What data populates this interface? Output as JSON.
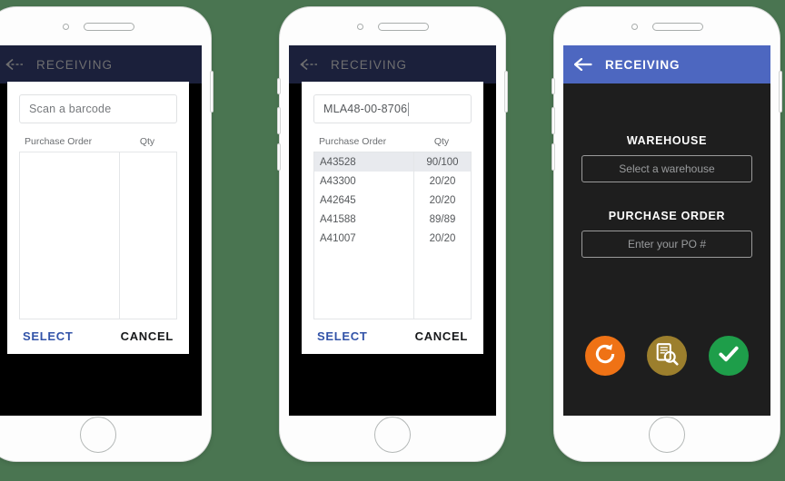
{
  "theme": {
    "page_background": "#4a7551",
    "header_navy": "#1b203b",
    "header_blue": "#4d67c0",
    "select_blue": "#3253a8",
    "cancel_black": "#16181a",
    "screen_black": "#000000",
    "screen_dark": "#1e1e1e",
    "orange": "#ef7215",
    "gold": "#9c7f2d",
    "green": "#1e9e4a"
  },
  "phones": [
    {
      "id": "phone-1",
      "header": {
        "title": "RECEIVING",
        "back_icon": "back-arrow-icon"
      },
      "modal": {
        "input": {
          "value": "",
          "placeholder": "Scan a barcode",
          "has_caret": false
        },
        "table": {
          "columns": [
            "Purchase Order",
            "Qty"
          ],
          "rows": []
        },
        "select_label": "SELECT",
        "cancel_label": "CANCEL"
      },
      "background_actions": [
        {
          "name": "refresh-icon",
          "color": "#ef7215"
        },
        {
          "name": "document-search-icon",
          "color": "#9c7f2d"
        },
        {
          "name": "check-icon",
          "color": "#1e9e4a"
        }
      ]
    },
    {
      "id": "phone-2",
      "header": {
        "title": "RECEIVING",
        "back_icon": "back-arrow-icon"
      },
      "modal": {
        "input": {
          "value": "MLA48-00-8706",
          "placeholder": "Scan a barcode",
          "has_caret": true
        },
        "table": {
          "columns": [
            "Purchase Order",
            "Qty"
          ],
          "rows": [
            {
              "po": "A43528",
              "qty": "90/100",
              "selected": true
            },
            {
              "po": "A43300",
              "qty": "20/20",
              "selected": false
            },
            {
              "po": "A42645",
              "qty": "20/20",
              "selected": false
            },
            {
              "po": "A41588",
              "qty": "89/89",
              "selected": false
            },
            {
              "po": "A41007",
              "qty": "20/20",
              "selected": false
            }
          ]
        },
        "select_label": "SELECT",
        "cancel_label": "CANCEL"
      },
      "background_actions": [
        {
          "name": "refresh-icon",
          "color": "#ef7215"
        },
        {
          "name": "document-search-icon",
          "color": "#9c7f2d"
        },
        {
          "name": "check-icon",
          "color": "#1e9e4a"
        }
      ]
    },
    {
      "id": "phone-3",
      "header": {
        "title": "RECEIVING",
        "back_icon": "back-arrow-icon"
      },
      "form": {
        "warehouse_label": "WAREHOUSE",
        "warehouse_placeholder": "Select a warehouse",
        "po_label": "PURCHASE ORDER",
        "po_placeholder": "Enter your PO #"
      },
      "actions": [
        {
          "name": "refresh-icon",
          "color": "#ef7215"
        },
        {
          "name": "document-search-icon",
          "color": "#9c7f2d"
        },
        {
          "name": "check-icon",
          "color": "#1e9e4a"
        }
      ]
    }
  ]
}
